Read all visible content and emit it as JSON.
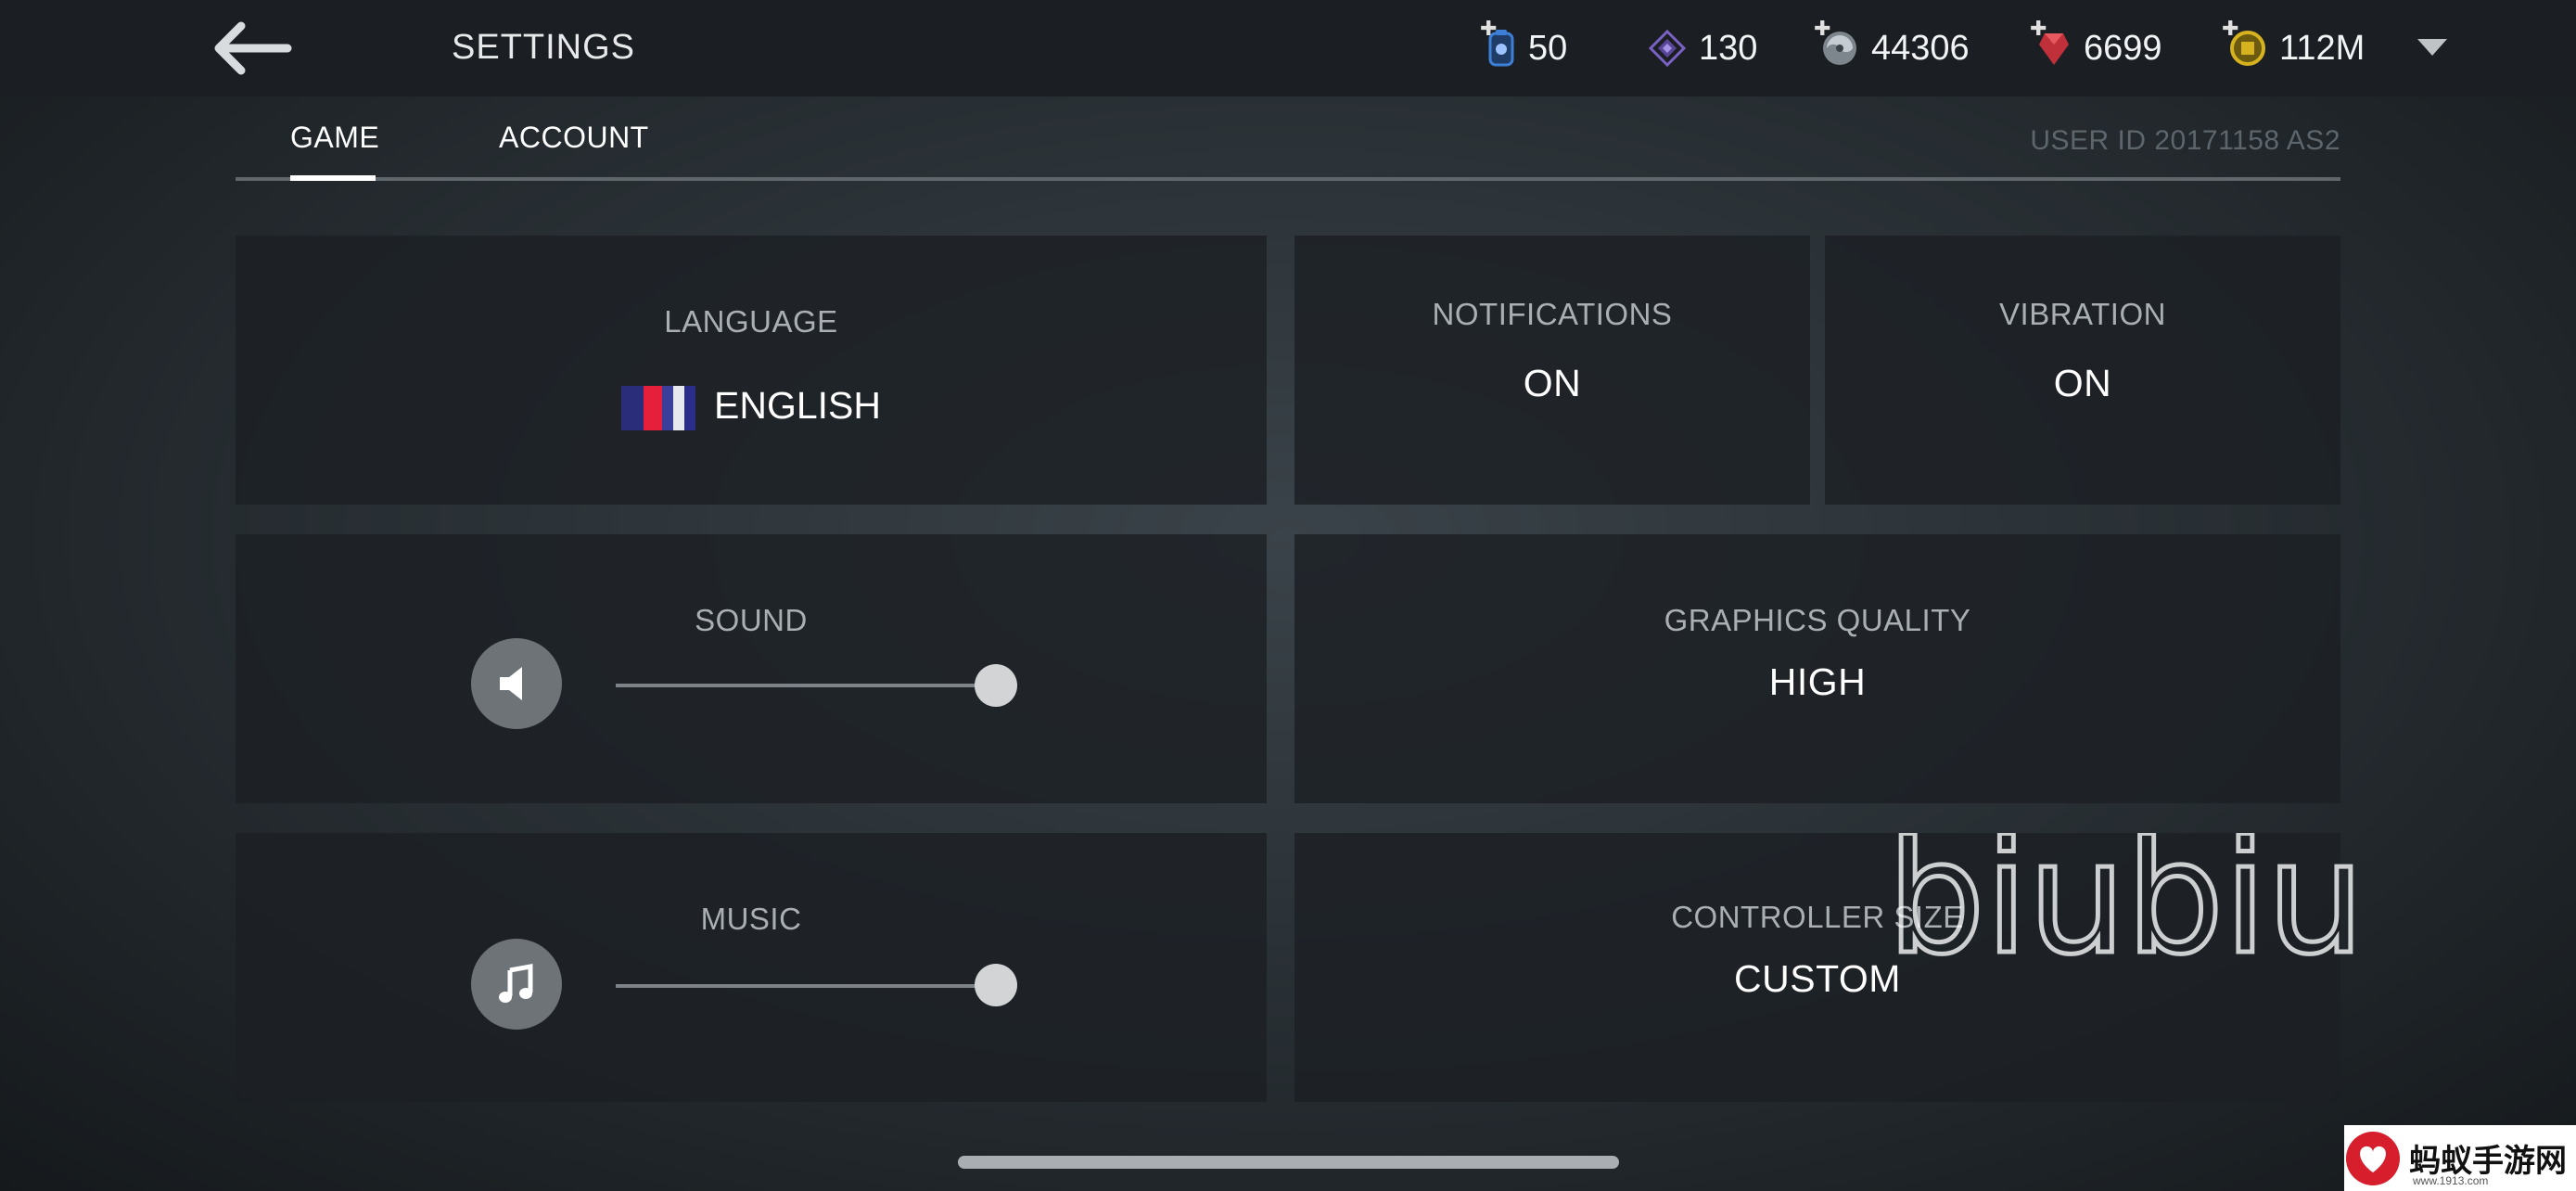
{
  "header": {
    "title": "SETTINGS",
    "currencies": [
      {
        "name": "energy",
        "value": "50",
        "icon": "energy-cell-icon",
        "color": "#3d7fd6"
      },
      {
        "name": "crystal",
        "value": "130",
        "icon": "purple-diamond-icon",
        "color": "#7a62c4"
      },
      {
        "name": "swirl",
        "value": "44306",
        "icon": "swirl-token-icon",
        "color": "#9aa3aa"
      },
      {
        "name": "gem",
        "value": "6699",
        "icon": "red-gem-icon",
        "color": "#d23a3a"
      },
      {
        "name": "coins",
        "value": "112M",
        "icon": "gold-coin-icon",
        "color": "#d6b21e"
      }
    ]
  },
  "tabs": {
    "game": "GAME",
    "account": "ACCOUNT",
    "active": "GAME"
  },
  "user_id": "USER ID 20171158 AS2",
  "settings": {
    "language": {
      "label": "LANGUAGE",
      "value": "ENGLISH"
    },
    "notifications": {
      "label": "NOTIFICATIONS",
      "value": "ON"
    },
    "vibration": {
      "label": "VIBRATION",
      "value": "ON"
    },
    "sound": {
      "label": "SOUND",
      "level_percent": 100
    },
    "graphics": {
      "label": "GRAPHICS QUALITY",
      "value": "HIGH"
    },
    "music": {
      "label": "MUSIC",
      "level_percent": 100
    },
    "controller": {
      "label": "CONTROLLER SIZE",
      "value": "CUSTOM"
    }
  },
  "watermark": "biubiu",
  "corner_logo": {
    "text": "蚂蚁手游网",
    "sub": "www.1913.com"
  }
}
